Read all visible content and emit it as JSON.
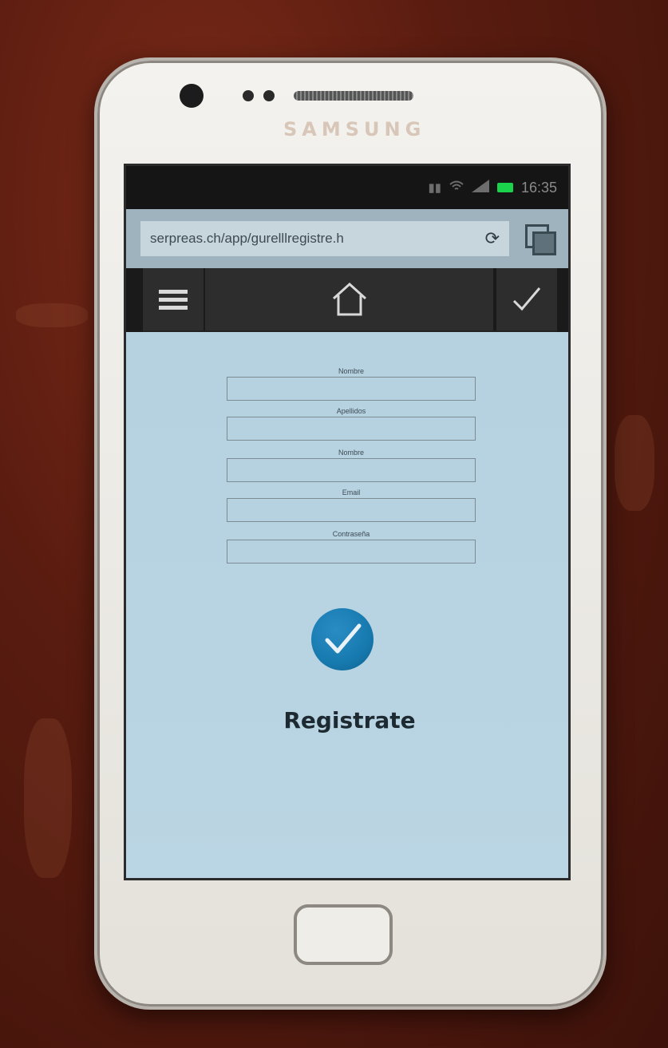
{
  "device": {
    "brand": "SAMSUNG"
  },
  "statusbar": {
    "time": "16:35"
  },
  "browser": {
    "url": "serpreas.ch/app/gurelllregistre.h",
    "refresh_icon": "refresh-icon",
    "tabs_icon": "tabs-icon"
  },
  "appbar": {
    "menu_icon": "hamburger-menu-icon",
    "home_icon": "home-icon",
    "check_icon": "check-icon"
  },
  "form": {
    "fields": [
      {
        "label": "Nombre",
        "value": ""
      },
      {
        "label": "Apellidos",
        "value": ""
      },
      {
        "label": "Nombre",
        "value": ""
      },
      {
        "label": "Email",
        "value": ""
      },
      {
        "label": "Contraseña",
        "value": ""
      }
    ],
    "submit_label": "Registrate",
    "submit_icon": "checkmark-circle-icon",
    "accent_color": "#177aaf"
  }
}
